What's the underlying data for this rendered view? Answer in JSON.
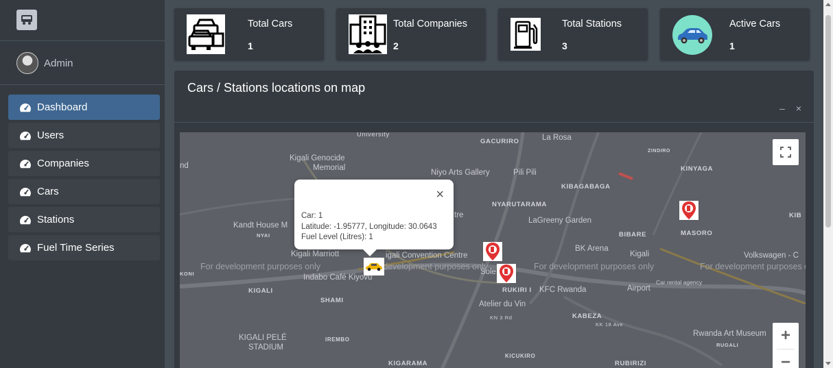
{
  "sidebar": {
    "user": "Admin",
    "items": [
      {
        "label": "Dashboard"
      },
      {
        "label": "Users"
      },
      {
        "label": "Companies"
      },
      {
        "label": "Cars"
      },
      {
        "label": "Stations"
      },
      {
        "label": "Fuel Time Series"
      }
    ]
  },
  "stats": [
    {
      "title": "Total Cars",
      "value": "1"
    },
    {
      "title": "Total Companies",
      "value": "2"
    },
    {
      "title": "Total Stations",
      "value": "3"
    },
    {
      "title": "Active Cars",
      "value": "1"
    }
  ],
  "map_card": {
    "title": "Cars / Stations locations on map",
    "minimize": "–",
    "close": "×"
  },
  "map": {
    "popup": {
      "close": "×",
      "car": "Car: 1",
      "coords": "Latitude: -1.95777, Longitude: 30.0643",
      "fuel": "Fuel Level (Litres): 1"
    },
    "dev_notice": "For development purposes only",
    "places": {
      "university": "University",
      "gacuriro": "GACURIRO",
      "larosa": "La Rosa",
      "zindiro": "ZINDIRO",
      "kinyaga": "KINYAGA",
      "hd": "nd",
      "genocide1": "Kigali Genocide",
      "genocide2": "Memorial",
      "niyo": "Niyo Arts Gallery",
      "pilipili": "Pili Pili",
      "kibagabaga": "KIBAGABAGA",
      "nyarutarama": "NYARUTARAMA",
      "lagreeny": "LaGreeny Garden",
      "kandt": "Kandt House M",
      "bibare": "BIBARE",
      "masoro": "MASORO",
      "kib": "KIB",
      "marriott": "Kigali Marriott",
      "convention": "igali Convention Centre",
      "bkarena": "BK Arena",
      "kigali_airport1": "Kigali",
      "airport2": "Airport",
      "volkswagen": "Volkswagen - C",
      "indabo": "Indabo Café Kiyovu",
      "kigali": "KIGALI",
      "rukiri": "RUKIRI I",
      "kfc": "KFC Rwanda",
      "rental": "Car rental agency",
      "shami": "SHAMI",
      "atelier": "Atelier du Vin",
      "kabeza": "KABEZA",
      "pele1": "KIGALI PELÉ",
      "pele2": "STADIUM",
      "iremb": "IREMBO",
      "kicukiro": "KICUKIRO",
      "rwanda_art": "Rwanda Art Museum",
      "rugali": "RUGALI",
      "kigarama": "KIGARAMA",
      "rubirizi": "RUBIRIZI",
      "kn3rd": "KN 3 Rd",
      "kk18": "KK 18 Ave",
      "koni": "KONI",
      "sole": "Sole",
      "centre": "tre",
      "nya": "NYAI"
    }
  }
}
